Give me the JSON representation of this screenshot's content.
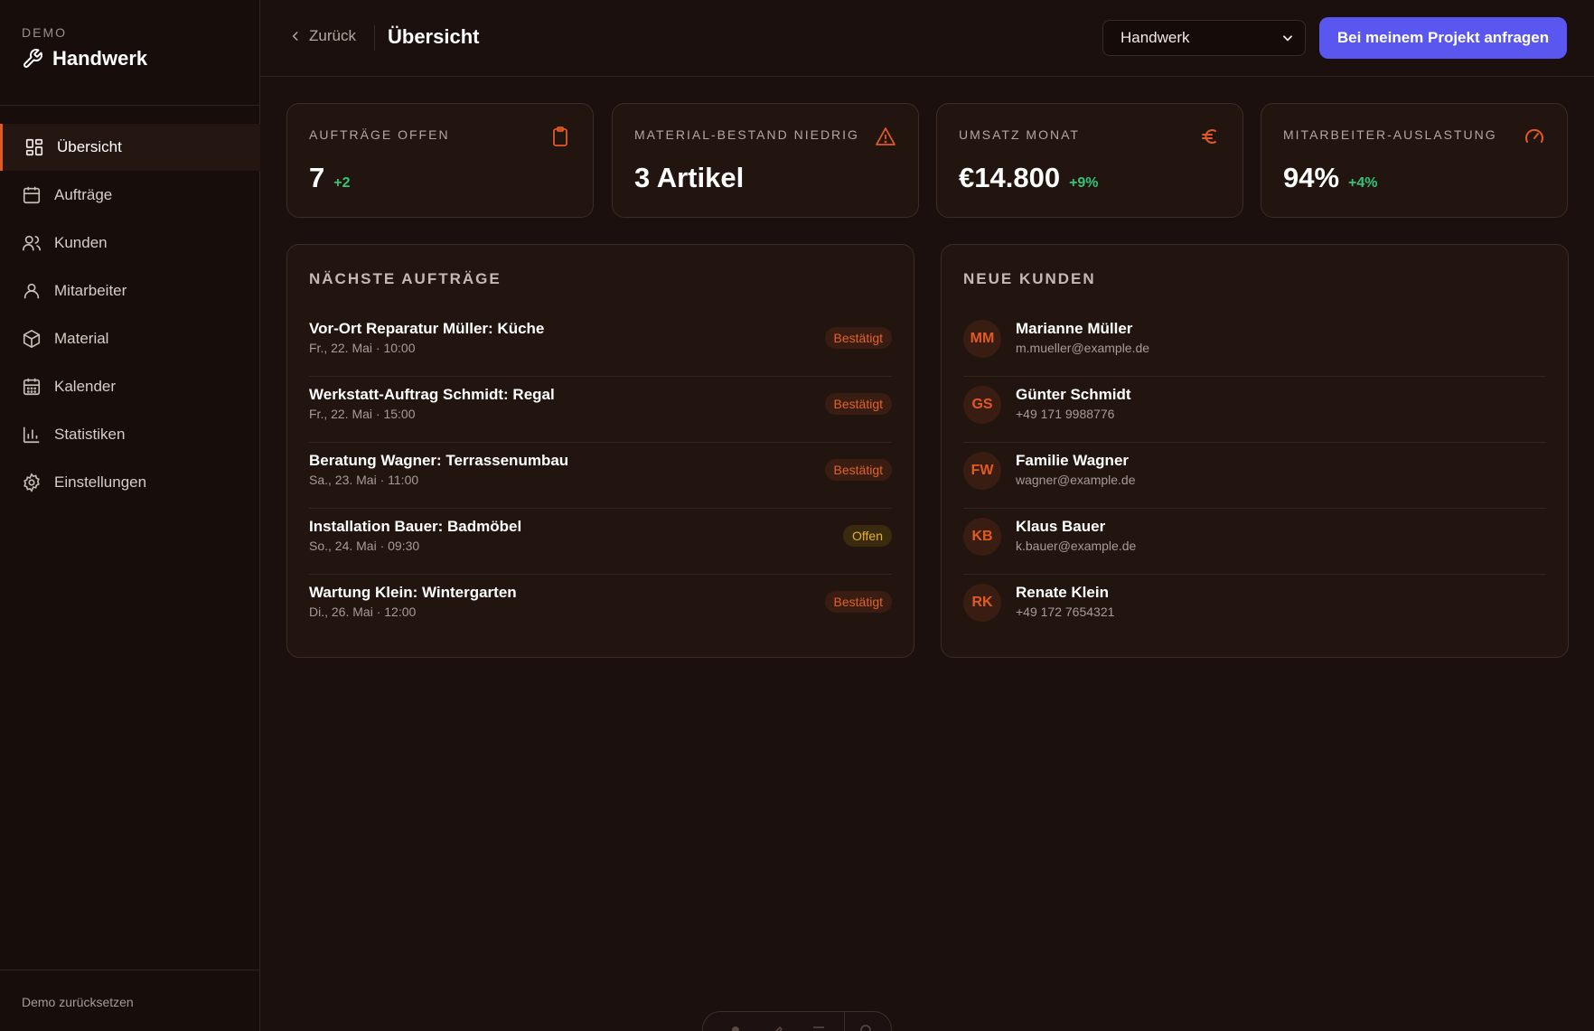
{
  "sidebar": {
    "demo_label": "DEMO",
    "brand_title": "Handwerk",
    "items": [
      {
        "label": "Übersicht",
        "icon": "grid-icon",
        "active": true
      },
      {
        "label": "Aufträge",
        "icon": "calendar-icon"
      },
      {
        "label": "Kunden",
        "icon": "users-icon"
      },
      {
        "label": "Mitarbeiter",
        "icon": "user-icon"
      },
      {
        "label": "Material",
        "icon": "box-icon"
      },
      {
        "label": "Kalender",
        "icon": "calendar-grid-icon"
      },
      {
        "label": "Statistiken",
        "icon": "bar-chart-icon"
      },
      {
        "label": "Einstellungen",
        "icon": "gear-icon"
      }
    ],
    "reset_label": "Demo zurücksetzen"
  },
  "header": {
    "back_label": "Zurück",
    "title": "Übersicht",
    "select_value": "Handwerk",
    "cta_label": "Bei meinem Projekt anfragen"
  },
  "stats": [
    {
      "label": "AUFTRÄGE OFFEN",
      "value": "7",
      "delta": "+2",
      "icon": "clipboard-icon"
    },
    {
      "label": "MATERIAL-BESTAND NIEDRIG",
      "value": "3 Artikel",
      "delta": "",
      "icon": "warning-icon"
    },
    {
      "label": "UMSATZ MONAT",
      "value": "€14.800",
      "delta": "+9%",
      "icon": "euro-icon"
    },
    {
      "label": "MITARBEITER-AUSLASTUNG",
      "value": "94%",
      "delta": "+4%",
      "icon": "gauge-icon"
    }
  ],
  "orders": {
    "title": "NÄCHSTE AUFTRÄGE",
    "rows": [
      {
        "title": "Vor-Ort Reparatur Müller: Küche",
        "sub": "Fr., 22. Mai · 10:00",
        "status": "Bestätigt"
      },
      {
        "title": "Werkstatt-Auftrag Schmidt: Regal",
        "sub": "Fr., 22. Mai · 15:00",
        "status": "Bestätigt"
      },
      {
        "title": "Beratung Wagner: Terrassenumbau",
        "sub": "Sa., 23. Mai · 11:00",
        "status": "Bestätigt"
      },
      {
        "title": "Installation Bauer: Badmöbel",
        "sub": "So., 24. Mai · 09:30",
        "status": "Offen"
      },
      {
        "title": "Wartung Klein: Wintergarten",
        "sub": "Di., 26. Mai · 12:00",
        "status": "Bestätigt"
      }
    ]
  },
  "customers": {
    "title": "NEUE KUNDEN",
    "rows": [
      {
        "initials": "MM",
        "name": "Marianne Müller",
        "contact": "m.mueller@example.de"
      },
      {
        "initials": "GS",
        "name": "Günter Schmidt",
        "contact": "+49 171 9988776"
      },
      {
        "initials": "FW",
        "name": "Familie Wagner",
        "contact": "wagner@example.de"
      },
      {
        "initials": "KB",
        "name": "Klaus Bauer",
        "contact": "k.bauer@example.de"
      },
      {
        "initials": "RK",
        "name": "Renate Klein",
        "contact": "+49 172 7654321"
      }
    ]
  },
  "colors": {
    "accent": "#e05a22",
    "cta": "#5a56f0",
    "positive": "#34c37a",
    "open": "#e3b235"
  }
}
